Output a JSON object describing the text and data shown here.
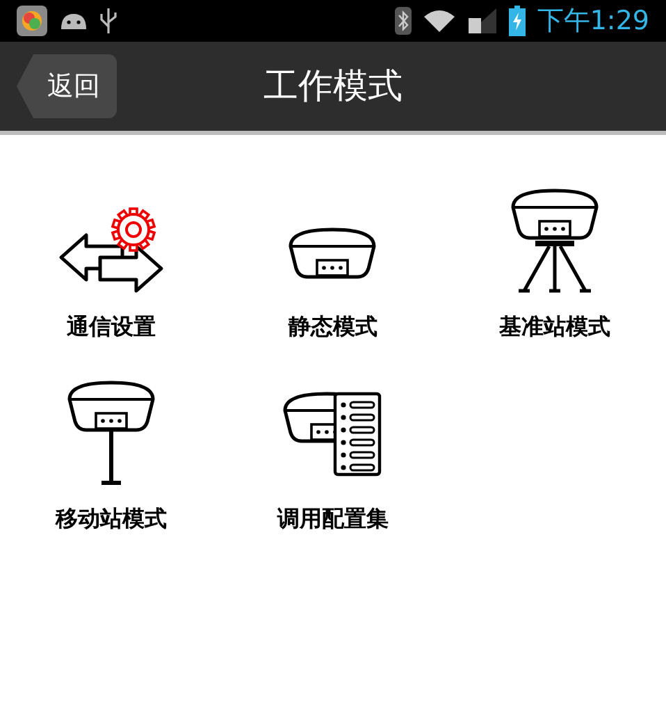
{
  "status_bar": {
    "time": "下午1:29"
  },
  "header": {
    "back": "返回",
    "title": "工作模式"
  },
  "items": [
    {
      "kind": "settings",
      "label": "通信设置"
    },
    {
      "kind": "static",
      "label": "静态模式"
    },
    {
      "kind": "base",
      "label": "基准站模式"
    },
    {
      "kind": "rover",
      "label": "移动站模式"
    },
    {
      "kind": "config",
      "label": "调用配置集"
    }
  ]
}
